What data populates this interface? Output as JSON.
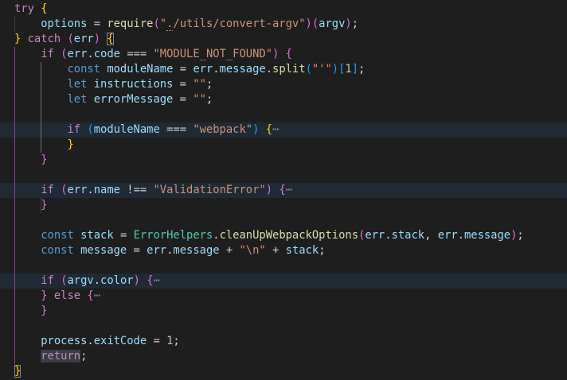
{
  "editor": {
    "lines": [
      {
        "kind": "try_open"
      },
      {
        "kind": "require",
        "module": "./utils/convert-argv",
        "arg": "argv"
      },
      {
        "kind": "catch_open",
        "param": "err"
      },
      {
        "kind": "if_code",
        "value": "MODULE_NOT_FOUND"
      },
      {
        "kind": "const_split",
        "sep": "'",
        "index": "1"
      },
      {
        "kind": "let_empty",
        "name": "instructions"
      },
      {
        "kind": "let_empty",
        "name": "errorMessage"
      },
      {
        "kind": "blank"
      },
      {
        "kind": "if_webpack",
        "value": "webpack"
      },
      {
        "kind": "close_inner"
      },
      {
        "kind": "close_outer"
      },
      {
        "kind": "blank"
      },
      {
        "kind": "if_name",
        "value": "ValidationError"
      },
      {
        "kind": "close_outer"
      },
      {
        "kind": "blank"
      },
      {
        "kind": "const_stack"
      },
      {
        "kind": "const_message",
        "newline": "\\n"
      },
      {
        "kind": "blank"
      },
      {
        "kind": "if_color"
      },
      {
        "kind": "else"
      },
      {
        "kind": "close_outer"
      },
      {
        "kind": "blank"
      },
      {
        "kind": "exit_code",
        "value": "1"
      },
      {
        "kind": "return"
      },
      {
        "kind": "close_catch"
      }
    ],
    "tokens": {
      "try": "try",
      "catch": "catch",
      "if": "if",
      "else": "else",
      "const": "const",
      "let": "let",
      "return": "return",
      "options": "options",
      "require": "require",
      "err": "err",
      "code": "code",
      "moduleName": "moduleName",
      "message": "message",
      "split": "split",
      "name": "name",
      "stack": "stack",
      "ErrorHelpers": "ErrorHelpers",
      "cleanUpWebpackOptions": "cleanUpWebpackOptions",
      "argv": "argv",
      "color": "color",
      "process": "process",
      "exitCode": "exitCode",
      "ellipsis": "⋯"
    }
  }
}
